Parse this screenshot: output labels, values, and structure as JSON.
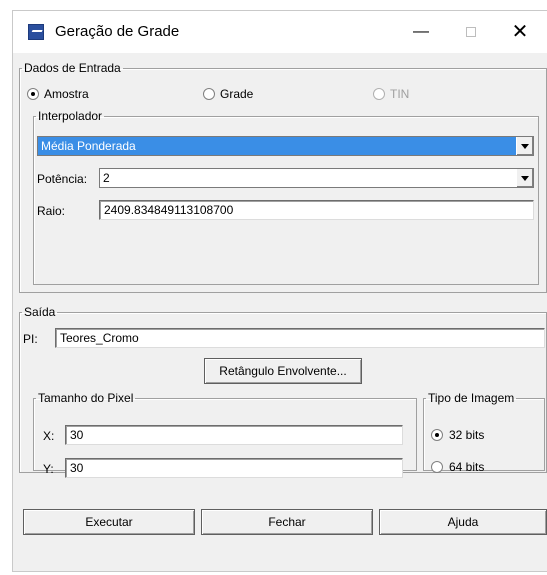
{
  "window": {
    "title": "Geração de Grade",
    "minimize_glyph": "—",
    "close_glyph": "✕"
  },
  "entrada": {
    "legend": "Dados de Entrada",
    "options": [
      {
        "label": "Amostra",
        "selected": true,
        "enabled": true
      },
      {
        "label": "Grade",
        "selected": false,
        "enabled": true
      },
      {
        "label": "TIN",
        "selected": false,
        "enabled": false
      }
    ]
  },
  "interpolador": {
    "legend": "Interpolador",
    "method": "Média Ponderada",
    "potencia_label": "Potência:",
    "potencia_value": "2",
    "raio_label": "Raio:",
    "raio_value": "2409.834849113108700"
  },
  "saida": {
    "legend": "Saída",
    "pi_label": "PI:",
    "pi_value": "Teores_Cromo",
    "retangulo_button": "Retângulo Envolvente..."
  },
  "pixel": {
    "legend": "Tamanho do Pixel",
    "x_label": "X:",
    "x_value": "30",
    "y_label": "Y:",
    "y_value": "30"
  },
  "tipo_imagem": {
    "legend": "Tipo de Imagem",
    "options": [
      {
        "label": "32 bits",
        "selected": true
      },
      {
        "label": "64 bits",
        "selected": false
      }
    ]
  },
  "actions": {
    "executar": "Executar",
    "fechar": "Fechar",
    "ajuda": "Ajuda"
  },
  "colors": {
    "selection": "#3a8ee6",
    "dialog_bg": "#f0f0f0"
  }
}
